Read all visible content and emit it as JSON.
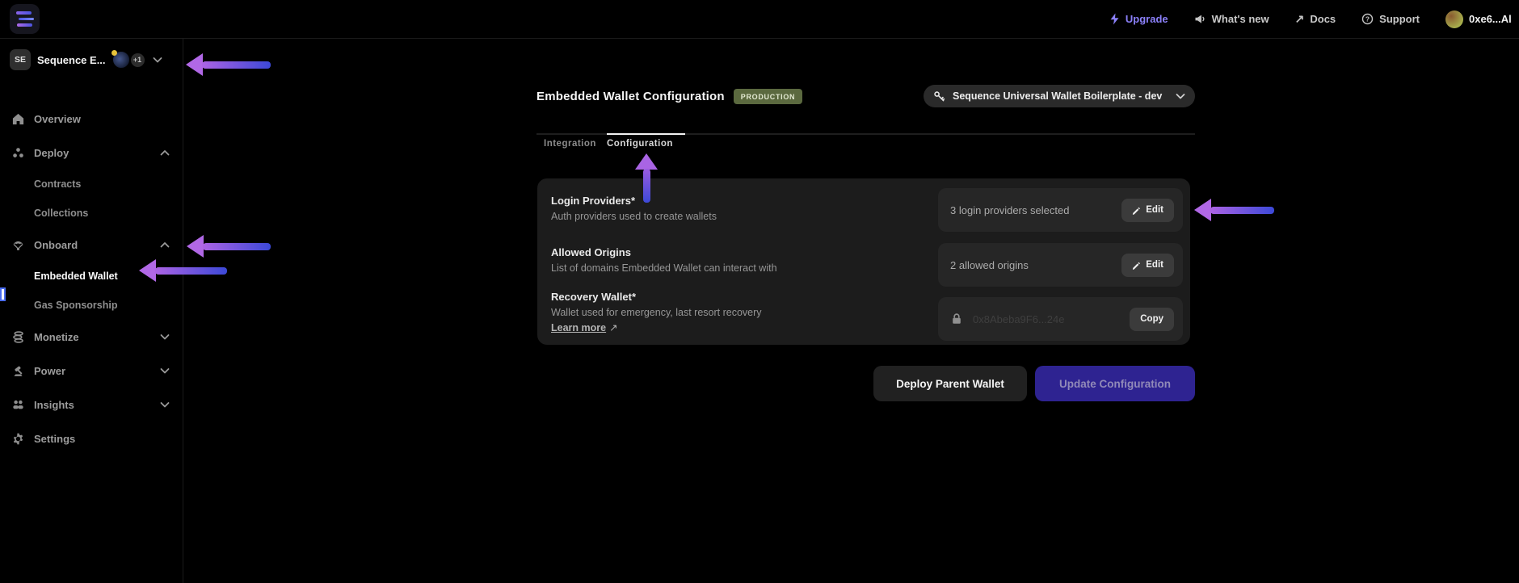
{
  "topbar": {
    "upgrade": "Upgrade",
    "whats_new": "What's new",
    "docs": "Docs",
    "support": "Support",
    "account": "0xe6...Al"
  },
  "sidebar": {
    "project": {
      "initials": "SE",
      "name": "Sequence E...",
      "extra_count": "+1"
    },
    "items": [
      {
        "label": "Overview"
      },
      {
        "label": "Deploy"
      },
      {
        "label": "Contracts"
      },
      {
        "label": "Collections"
      },
      {
        "label": "Onboard"
      },
      {
        "label": "Embedded Wallet"
      },
      {
        "label": "Gas Sponsorship"
      },
      {
        "label": "Monetize"
      },
      {
        "label": "Power"
      },
      {
        "label": "Insights"
      },
      {
        "label": "Settings"
      }
    ]
  },
  "main": {
    "title": "Embedded Wallet Configuration",
    "badge": "PRODUCTION",
    "wallet_selector": "Sequence Universal Wallet Boilerplate - dev",
    "tabs": [
      {
        "label": "Integration"
      },
      {
        "label": "Configuration"
      }
    ],
    "card": {
      "rows": [
        {
          "title": "Login Providers*",
          "desc": "Auth providers used to create wallets",
          "value": "3 login providers selected",
          "action": "Edit"
        },
        {
          "title": "Allowed Origins",
          "desc": "List of domains Embedded Wallet can interact with",
          "value": "2 allowed origins",
          "action": "Edit"
        },
        {
          "title": "Recovery Wallet*",
          "desc": "Wallet used for emergency, last resort recovery",
          "link": "Learn more",
          "link_suffix": "↗",
          "value": "0x8Abeba9F6...24e",
          "action": "Copy"
        }
      ]
    },
    "buttons": {
      "deploy": "Deploy Parent Wallet",
      "update": "Update Configuration"
    }
  },
  "colors": {
    "accent_purple": "#8b80f9",
    "badge_bg": "#5b693f",
    "update_button_bg": "#2e2391",
    "arrow_violet": "#ac63e4",
    "arrow_blue": "#3c49d8"
  }
}
